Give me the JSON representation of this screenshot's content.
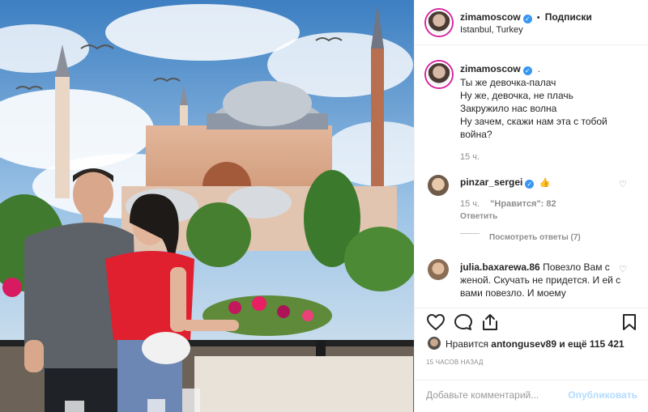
{
  "post": {
    "image_alt": "Photo"
  },
  "header": {
    "username": "zimamoscow",
    "separator": "•",
    "follow_label": "Подписки",
    "location": "Istanbul, Turkey"
  },
  "caption": {
    "username": "zimamoscow",
    "dot": ".",
    "text": "Ты же девочка-палач\nНу же, девочка, не плачь\nЗакружило нас волна\nНу зачем, скажи нам эта с тобой война?",
    "time": "15 ч."
  },
  "comments": [
    {
      "username": "pinzar_sergei",
      "text": "👍",
      "time": "15 ч.",
      "likes": "\"Нравится\": 82",
      "reply_label": "Ответить",
      "view_replies": "Посмотреть ответы (7)"
    },
    {
      "username": "julia.baxarewa.86",
      "text": "Повезло Вам с женой. Скучать не придется. И ей с вами повезло. И моему"
    }
  ],
  "likes": {
    "prefix": "Нравится",
    "user": "antongusev89",
    "suffix": "и ещё 115 421"
  },
  "timestamp": "15 ЧАСОВ НАЗАД",
  "footer": {
    "comment_placeholder": "Добавьте комментарий...",
    "publish_label": "Опубликовать"
  },
  "colors": {
    "accent": "#3897f0",
    "publish_disabled": "#b3dbff",
    "muted": "#8e8e8e",
    "text": "#262626"
  },
  "icons": {
    "like": "heart-icon",
    "comment": "comment-icon",
    "share": "share-icon",
    "save": "bookmark-icon",
    "verified": "verified-badge-icon"
  }
}
